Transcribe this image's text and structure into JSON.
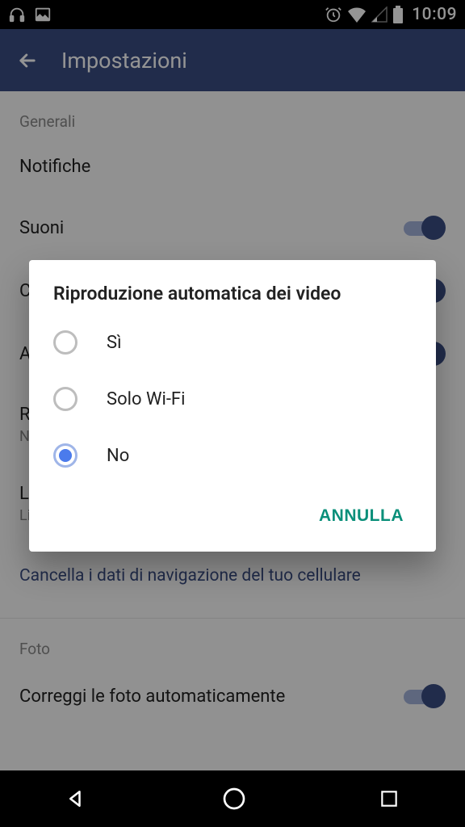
{
  "status": {
    "time": "10:09"
  },
  "appbar": {
    "title": "Impostazioni"
  },
  "sections": {
    "general_label": "Generali",
    "photo_label": "Foto"
  },
  "items": {
    "notifications": "Notifiche",
    "sounds": "Suoni",
    "c_trunc": "C",
    "a_trunc": "A",
    "r_trunc": "R",
    "n_trunc": "N",
    "li_trunc": "Li",
    "lang_sub": "Lingua del dispositivo",
    "clear_data": "Cancella i dati di navigazione del tuo cellulare",
    "auto_photo": "Correggi le foto automaticamente"
  },
  "dialog": {
    "title": "Riproduzione automatica dei video",
    "options": [
      {
        "label": "Sì",
        "selected": false
      },
      {
        "label": "Solo Wi-Fi",
        "selected": false
      },
      {
        "label": "No",
        "selected": true
      }
    ],
    "cancel": "ANNULLA"
  }
}
